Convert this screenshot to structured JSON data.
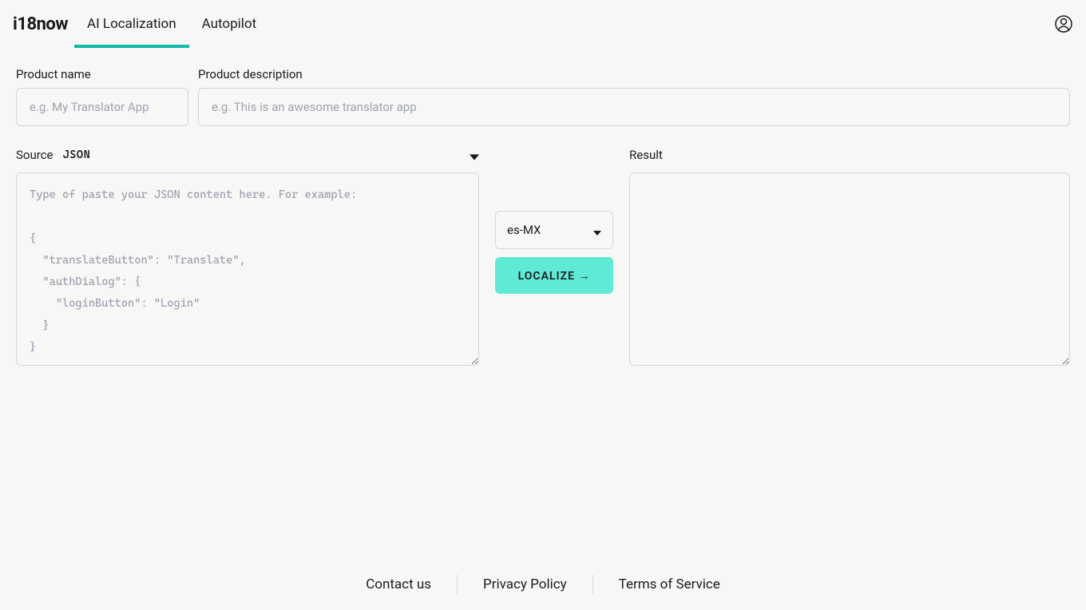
{
  "header": {
    "logo": "i18now",
    "tabs": [
      {
        "label": "AI Localization",
        "active": true
      },
      {
        "label": "Autopilot",
        "active": false
      }
    ]
  },
  "form": {
    "product_name": {
      "label": "Product name",
      "placeholder": "e.g. My Translator App",
      "value": ""
    },
    "product_description": {
      "label": "Product description",
      "placeholder": "e.g. This is an awesome translator app",
      "value": ""
    },
    "source": {
      "label": "Source",
      "format_badge": "JSON",
      "placeholder": "Type of paste your JSON content here. For example:\n\n{\n  \"translateButton\": \"Translate\",\n  \"authDialog\": {\n    \"loginButton\": \"Login\"\n  }\n}",
      "value": ""
    },
    "locale_select": {
      "selected": "es-MX"
    },
    "localize_button": {
      "label": "LOCALIZE →"
    },
    "result": {
      "label": "Result",
      "value": ""
    }
  },
  "footer": {
    "links": [
      {
        "label": "Contact us"
      },
      {
        "label": "Privacy Policy"
      },
      {
        "label": "Terms of Service"
      }
    ]
  }
}
